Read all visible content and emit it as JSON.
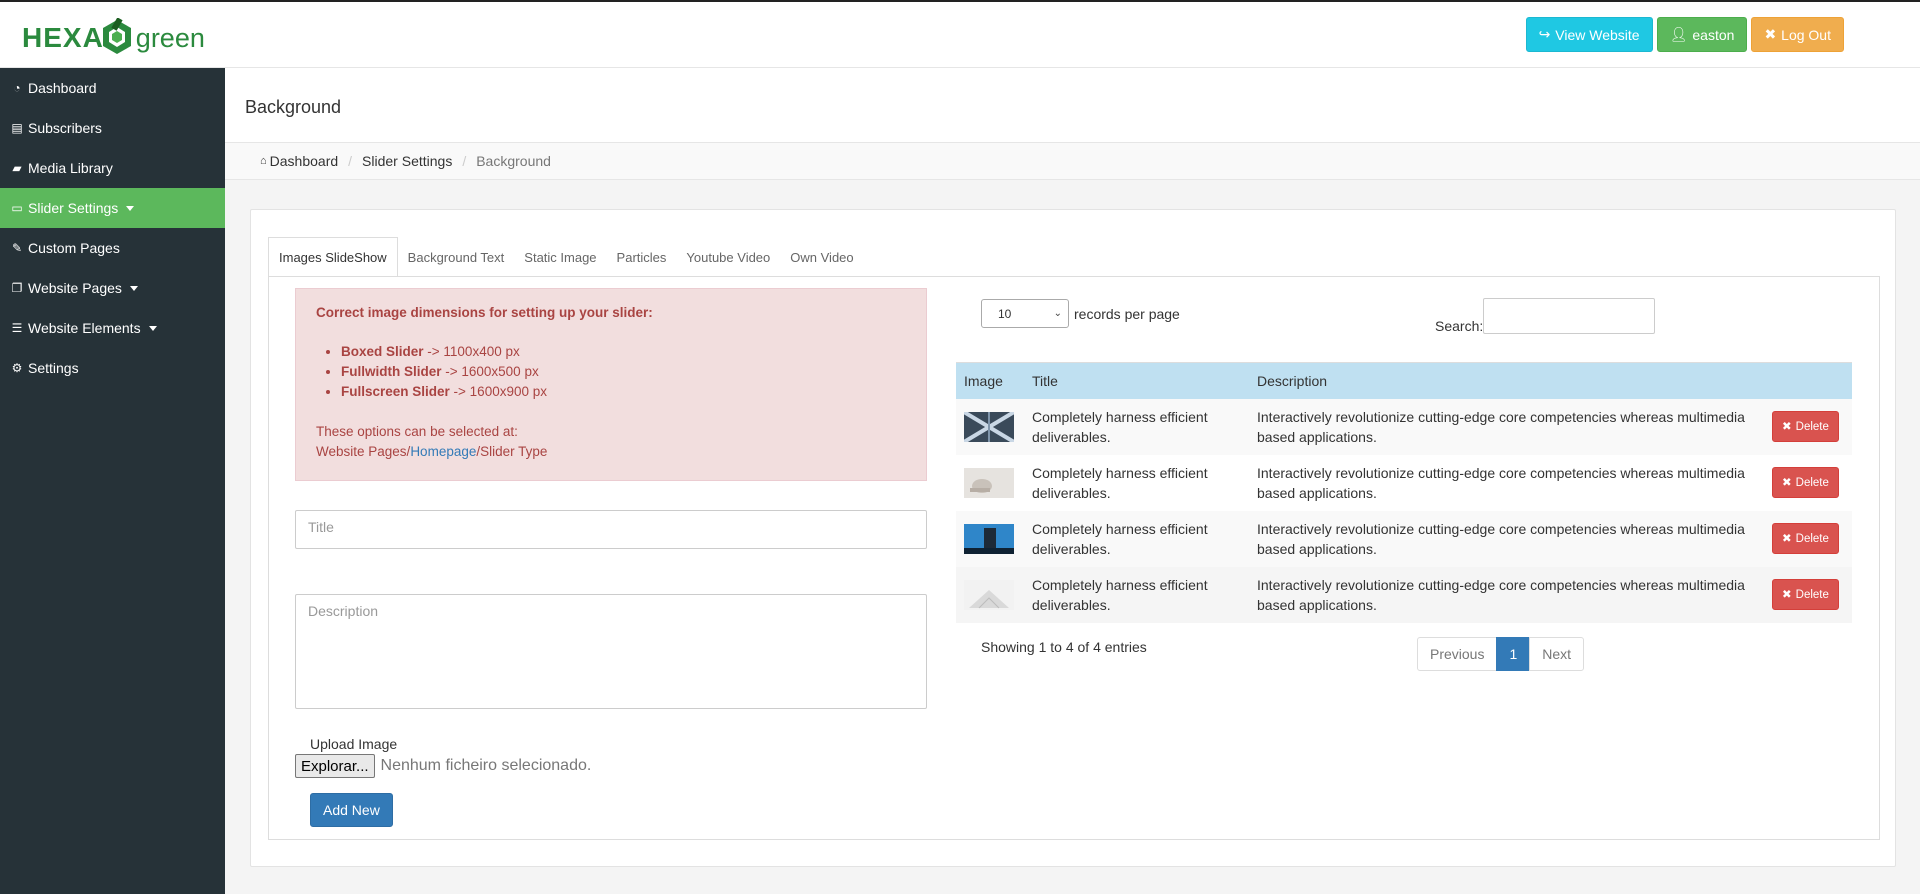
{
  "brand": {
    "part1": "HEXA",
    "part2": "green"
  },
  "top_actions": [
    {
      "label": "View Website",
      "icon": "external-link-icon"
    },
    {
      "label": "easton",
      "icon": "user-icon"
    },
    {
      "label": "Log Out",
      "icon": "close-icon"
    }
  ],
  "sidebar": {
    "items": [
      {
        "label": "Dashboard",
        "icon": "dashboard-icon"
      },
      {
        "label": "Subscribers",
        "icon": "newspaper-icon"
      },
      {
        "label": "Media Library",
        "icon": "folder-icon"
      },
      {
        "label": "Slider Settings",
        "icon": "monitor-icon"
      },
      {
        "label": "Custom Pages",
        "icon": "edit-icon"
      },
      {
        "label": "Website Pages",
        "icon": "copy-icon"
      },
      {
        "label": "Website Elements",
        "icon": "bars-icon"
      },
      {
        "label": "Settings",
        "icon": "gears-icon"
      }
    ]
  },
  "page": {
    "title": "Background"
  },
  "breadcrumb": {
    "home": "Dashboard",
    "parent": "Slider Settings",
    "current": "Background"
  },
  "tabs": [
    "Images SlideShow",
    "Background Text",
    "Static Image",
    "Particles",
    "Youtube Video",
    "Own Video"
  ],
  "alert": {
    "heading": "Correct image dimensions for setting up your slider:",
    "items": [
      {
        "name": "Boxed Slider",
        "size": " -> 1100x400 px"
      },
      {
        "name": "Fullwidth Slider",
        "size": " -> 1600x500 px"
      },
      {
        "name": "Fullscreen Slider",
        "size": " -> 1600x900 px"
      }
    ],
    "options_line1": "These options can be selected at:",
    "options_prefix": "Website Pages/",
    "options_link": "Homepage",
    "options_suffix": "/Slider Type"
  },
  "form": {
    "title_placeholder": "Title",
    "description_placeholder": "Description",
    "upload_label": "Upload Image",
    "file_button": "Explorar...",
    "file_status": "Nenhum ficheiro selecionado.",
    "add_button": "Add New"
  },
  "datatable": {
    "length_value": "10",
    "length_suffix": "records per page",
    "search_label": "Search:",
    "columns": [
      "Image",
      "Title",
      "Description",
      ""
    ],
    "rows": [
      {
        "title": "Completely harness efficient deliverables.",
        "description": "Interactively revolutionize cutting-edge core competencies whereas multimedia based applications.",
        "action": "Delete"
      },
      {
        "title": "Completely harness efficient deliverables.",
        "description": "Interactively revolutionize cutting-edge core competencies whereas multimedia based applications.",
        "action": "Delete"
      },
      {
        "title": "Completely harness efficient deliverables.",
        "description": "Interactively revolutionize cutting-edge core competencies whereas multimedia based applications.",
        "action": "Delete"
      },
      {
        "title": "Completely harness efficient deliverables.",
        "description": "Interactively revolutionize cutting-edge core competencies whereas multimedia based applications.",
        "action": "Delete"
      }
    ],
    "info": "Showing 1 to 4 of 4 entries",
    "pagination": {
      "previous": "Previous",
      "current": "1",
      "next": "Next"
    }
  },
  "colors": {
    "sidebar_bg": "#263238",
    "active_green": "#5cb85c",
    "info": "#1fc8e3",
    "warning": "#f0ad4e",
    "danger": "#d9534f",
    "primary": "#337ab7"
  }
}
